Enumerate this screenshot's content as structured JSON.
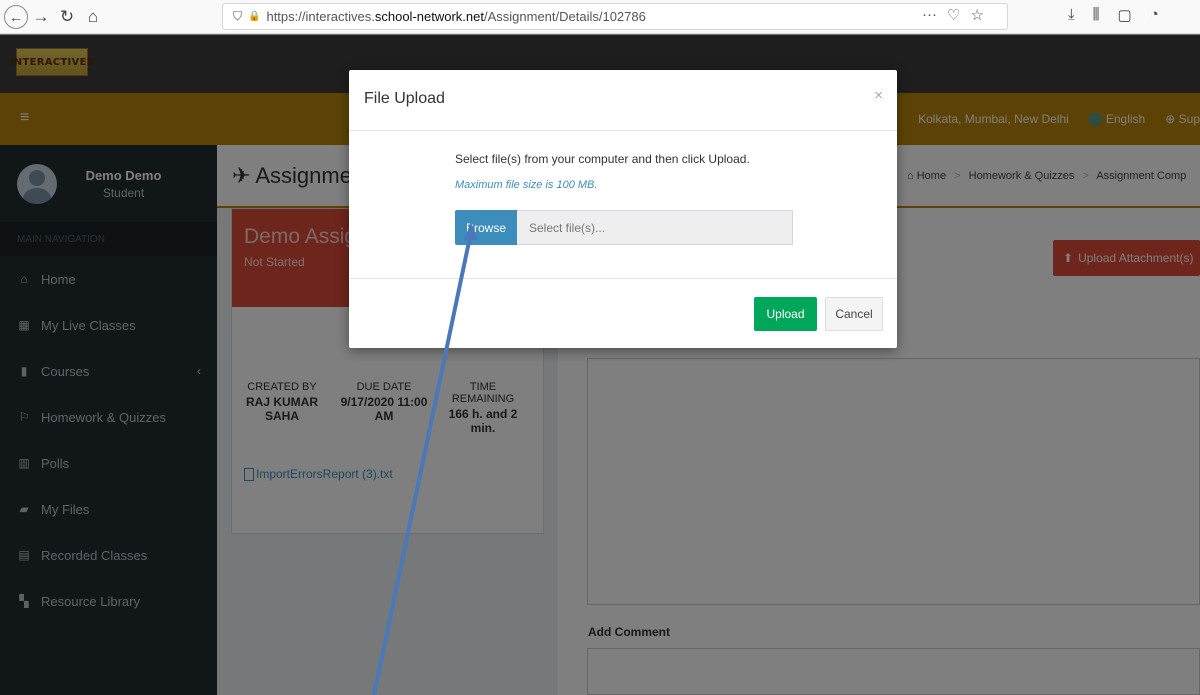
{
  "browser": {
    "url_prefix": "https://interactives.",
    "url_host": "school-network.net",
    "url_path": "/Assignment/Details/102786",
    "page_actions": "···",
    "back_glyph": "←",
    "forward_glyph": "→",
    "reload_glyph": "↻",
    "home_glyph": "⌂",
    "shield_glyph": "⛉",
    "lock_glyph": "🔒",
    "pocket_glyph": "♡",
    "bookmark_glyph": "☆",
    "download_glyph": "⤓",
    "library_glyph": "⫼",
    "sidebar_glyph": "▢",
    "account_glyph": "◔"
  },
  "app": {
    "logo_text": "INTERACTIVES",
    "hamburger_glyph": "≡",
    "location": "Kolkata, Mumbai, New Delhi",
    "language": "English",
    "support": "Sup",
    "globe_glyph": "🌐",
    "support_glyph": "⊕"
  },
  "user": {
    "name": "Demo Demo",
    "role": "Student"
  },
  "sidebar": {
    "header": "MAIN NAVIGATION",
    "items": [
      {
        "label": "Home",
        "icon": "⌂"
      },
      {
        "label": "My Live Classes",
        "icon": "▦"
      },
      {
        "label": "Courses",
        "icon": "▮",
        "chevron": "‹"
      },
      {
        "label": "Homework & Quizzes",
        "icon": "⚐"
      },
      {
        "label": "Polls",
        "icon": "▥"
      },
      {
        "label": "My Files",
        "icon": "▰"
      },
      {
        "label": "Recorded Classes",
        "icon": "▤"
      },
      {
        "label": "Resource Library",
        "icon": "▚"
      }
    ]
  },
  "content": {
    "title": "Assignme",
    "title_glyph": "✈",
    "breadcrumb": [
      "Home",
      "Homework & Quizzes",
      "Assignment Comp"
    ],
    "breadcrumb_home_glyph": "⌂",
    "breadcrumb_sep": ">"
  },
  "assignment": {
    "title": "Demo Assig",
    "status": "Not Started",
    "created_by_label": "CREATED BY",
    "created_by": "RAJ KUMAR SAHA",
    "due_date_label": "DUE DATE",
    "due_date": "9/17/2020 11:00 AM",
    "time_remaining_label": "TIME REMAINING",
    "time_remaining": "166 h. and 2 min.",
    "attachment": "ImportErrorsReport (3).txt"
  },
  "right": {
    "upload_attachments": "Upload Attachment(s)",
    "upload_glyph": "⬆",
    "add_comment": "Add Comment"
  },
  "modal": {
    "title": "File Upload",
    "close": "×",
    "instruction": "Select file(s) from your computer and then click Upload.",
    "max_size": "Maximum file size is 100 MB.",
    "browse": "Browse",
    "placeholder": "Select file(s)...",
    "upload": "Upload",
    "cancel": "Cancel"
  },
  "colors": {
    "header": "#b8860b",
    "sidebar": "#222d32",
    "danger": "#dd4b39",
    "primary": "#3c8dbc",
    "success": "#00a65a",
    "arrow": "#4a78b8"
  }
}
